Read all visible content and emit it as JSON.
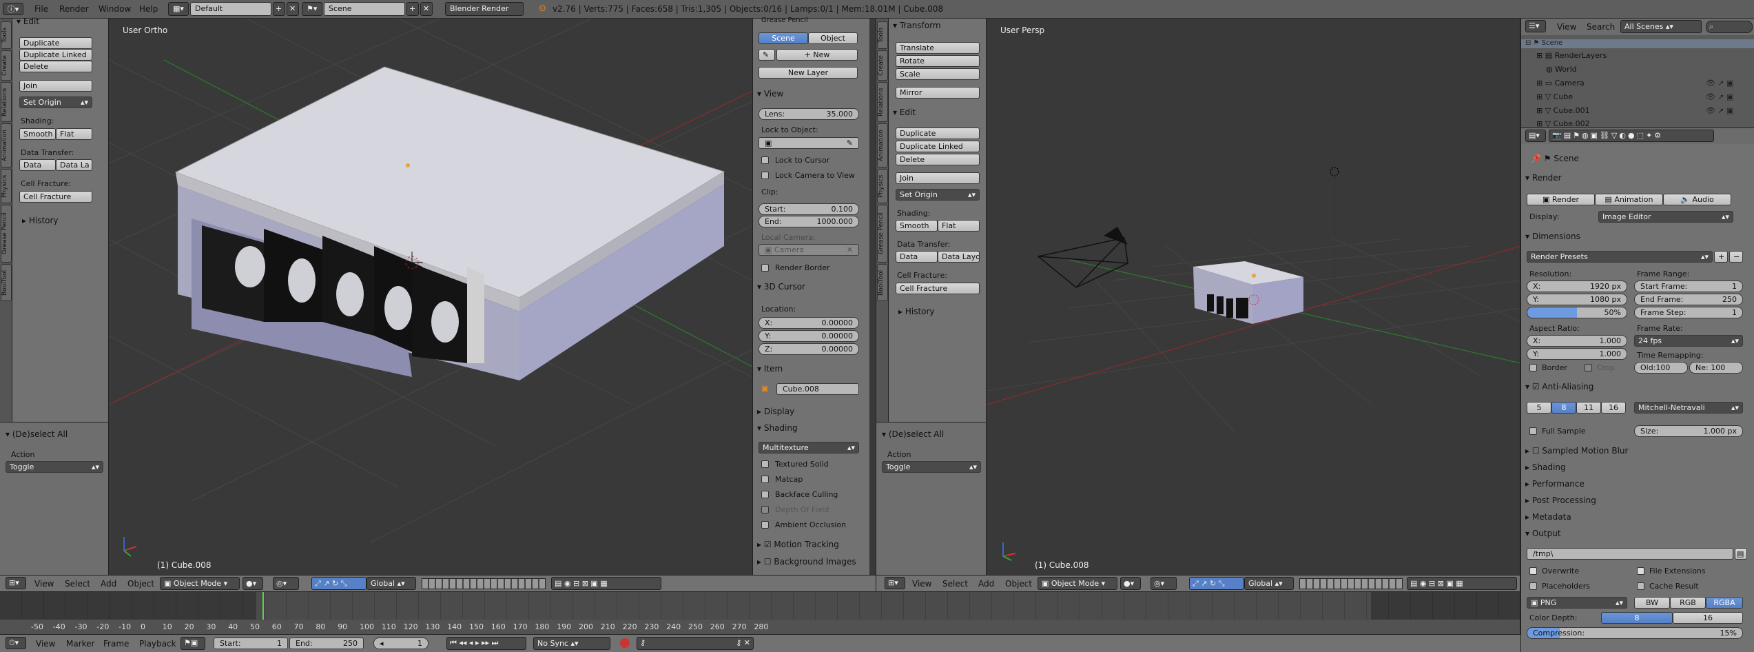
{
  "topbar": {
    "menus": [
      "File",
      "Render",
      "Window",
      "Help"
    ],
    "screen": "Default",
    "scene": "Scene",
    "engine": "Blender Render",
    "stats": "v2.76 | Verts:775 | Faces:658 | Tris:1,305 | Objects:0/16 | Lamps:0/1 | Mem:18.01M | Cube.008"
  },
  "left_toolshelf": {
    "tabs": [
      "Tools",
      "Create",
      "Relations",
      "Animation",
      "Physics",
      "Grease Pencil",
      "BoolTool"
    ],
    "section_edit": "Edit",
    "duplicate": "Duplicate",
    "duplicate_linked": "Duplicate Linked",
    "delete": "Delete",
    "join": "Join",
    "set_origin": "Set Origin",
    "shading_label": "Shading:",
    "smooth": "Smooth",
    "flat": "Flat",
    "data_transfer_label": "Data Transfer:",
    "data": "Data",
    "data_layout": "Data La",
    "cell_fracture_label": "Cell Fracture:",
    "cell_fracture": "Cell Fracture",
    "history": "History",
    "deselect_all": "(De)select All",
    "action_label": "Action",
    "action_value": "Toggle"
  },
  "viewport_left": {
    "label": "User Ortho",
    "object": "(1) Cube.008"
  },
  "properties_n": {
    "grease_pencil": "Grease Pencil",
    "scene_tab": "Scene",
    "object_tab": "Object",
    "new": "New",
    "new_layer": "New Layer",
    "view": "View",
    "lens_label": "Lens:",
    "lens_value": "35.000",
    "lock_to_object": "Lock to Object:",
    "lock_to_cursor": "Lock to Cursor",
    "lock_camera": "Lock Camera to View",
    "clip": "Clip:",
    "start_label": "Start:",
    "start_value": "0.100",
    "end_label": "End:",
    "end_value": "1000.000",
    "local_camera": "Local Camera:",
    "camera": "Camera",
    "render_border": "Render Border",
    "cursor": "3D Cursor",
    "location": "Location:",
    "x_label": "X:",
    "x_value": "0.00000",
    "y_label": "Y:",
    "y_value": "0.00000",
    "z_label": "Z:",
    "z_value": "0.00000",
    "item": "Item",
    "item_name": "Cube.008",
    "display": "Display",
    "shading": "Shading",
    "shading_mode": "Multitexture",
    "textured_solid": "Textured Solid",
    "matcap": "Matcap",
    "backface": "Backface Culling",
    "dof": "Depth Of Field",
    "ao": "Ambient Occlusion",
    "motion_tracking": "Motion Tracking",
    "background_images": "Background Images"
  },
  "right_toolshelf": {
    "tabs": [
      "Tools",
      "Create",
      "Relations",
      "Animation",
      "Physics",
      "Grease Pencil",
      "BoolTool"
    ],
    "transform": "Transform",
    "translate": "Translate",
    "rotate": "Rotate",
    "scale": "Scale",
    "mirror": "Mirror",
    "edit": "Edit",
    "duplicate": "Duplicate",
    "duplicate_linked": "Duplicate Linked",
    "delete": "Delete",
    "join": "Join",
    "set_origin": "Set Origin",
    "shading_label": "Shading:",
    "smooth": "Smooth",
    "flat": "Flat",
    "data_transfer_label": "Data Transfer:",
    "data": "Data",
    "data_layout": "Data Layo",
    "cell_fracture_label": "Cell Fracture:",
    "cell_fracture": "Cell Fracture",
    "history": "History",
    "deselect_all": "(De)select All",
    "action_label": "Action",
    "action_value": "Toggle"
  },
  "viewport_right": {
    "label": "User Persp",
    "object": "(1) Cube.008"
  },
  "view_header": {
    "view": "View",
    "select": "Select",
    "add": "Add",
    "object": "Object",
    "mode": "Object Mode",
    "orientation": "Global"
  },
  "outliner": {
    "view": "View",
    "search": "Search",
    "scenes": "All Scenes",
    "items": [
      "Scene",
      "RenderLayers",
      "World",
      "Camera",
      "Cube",
      "Cube.001",
      "Cube.002"
    ]
  },
  "render": {
    "breadcrumb": "Scene",
    "render_section": "Render",
    "render_btn": "Render",
    "animation_btn": "Animation",
    "audio_btn": "Audio",
    "display_label": "Display:",
    "display_value": "Image Editor",
    "dimensions": "Dimensions",
    "presets": "Render Presets",
    "resolution": "Resolution:",
    "res_x_label": "X:",
    "res_x": "1920 px",
    "res_y_label": "Y:",
    "res_y": "1080 px",
    "res_pct": "50%",
    "frame_range": "Frame Range:",
    "start_frame_label": "Start Frame:",
    "start_frame": "1",
    "end_frame_label": "End Frame:",
    "end_frame": "250",
    "frame_step_label": "Frame Step:",
    "frame_step": "1",
    "aspect": "Aspect Ratio:",
    "asp_x": "1.000",
    "asp_y": "1.000",
    "frame_rate": "Frame Rate:",
    "fps": "24 fps",
    "time_remap": "Time Remapping:",
    "old": "Old:100",
    "new": "Ne: 100",
    "border": "Border",
    "crop": "Crop",
    "aa": "Anti-Aliasing",
    "aa_samples": [
      "5",
      "8",
      "11",
      "16"
    ],
    "filter": "Mitchell-Netravali",
    "full_sample": "Full Sample",
    "size_label": "Size:",
    "size": "1.000 px",
    "motion_blur": "Sampled Motion Blur",
    "shading": "Shading",
    "performance": "Performance",
    "post": "Post Processing",
    "metadata": "Metadata",
    "output": "Output",
    "path": "/tmp\\",
    "overwrite": "Overwrite",
    "file_ext": "File Extensions",
    "placeholders": "Placeholders",
    "cache": "Cache Result",
    "format": "PNG",
    "bw": "BW",
    "rgb": "RGB",
    "rgba": "RGBA",
    "color_depth": "Color Depth:",
    "depth8": "8",
    "depth16": "16",
    "compression_label": "Compression:",
    "compression": "15%"
  },
  "timeline": {
    "ticks": [
      "-50",
      "-40",
      "-30",
      "-20",
      "-10",
      "0",
      "10",
      "20",
      "30",
      "40",
      "50",
      "60",
      "70",
      "80",
      "90",
      "100",
      "110",
      "120",
      "130",
      "140",
      "150",
      "160",
      "170",
      "180",
      "190",
      "200",
      "210",
      "220",
      "230",
      "240",
      "250",
      "260",
      "270",
      "280"
    ],
    "view": "View",
    "marker": "Marker",
    "frame": "Frame",
    "playback": "Playback",
    "start_label": "Start:",
    "start": "1",
    "end_label": "End:",
    "end": "250",
    "current": "1",
    "sync": "No Sync"
  }
}
